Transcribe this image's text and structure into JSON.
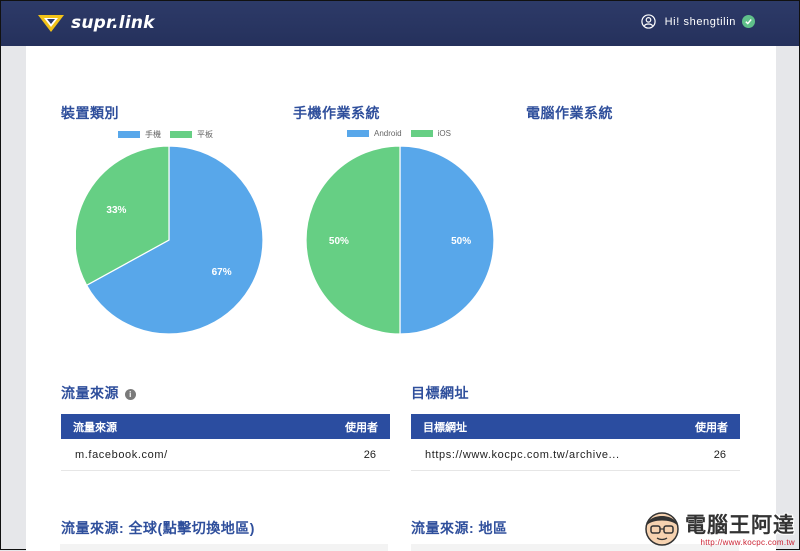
{
  "header": {
    "brand": "supr.link",
    "greeting": "Hi! shengtilin"
  },
  "charts": {
    "device": {
      "title": "裝置類別"
    },
    "mobile_os": {
      "title": "手機作業系統"
    },
    "desktop_os": {
      "title": "電腦作業系統"
    }
  },
  "chart_data": [
    {
      "type": "pie",
      "title": "裝置類別",
      "labels": [
        "手機",
        "平板"
      ],
      "values": [
        67,
        33
      ],
      "value_labels": [
        "67%",
        "33%"
      ],
      "colors": [
        "#58a7ea",
        "#66cf84"
      ],
      "legend": "top"
    },
    {
      "type": "pie",
      "title": "手機作業系統",
      "labels": [
        "Android",
        "iOS"
      ],
      "values": [
        50,
        50
      ],
      "value_labels": [
        "50%",
        "50%"
      ],
      "colors": [
        "#58a7ea",
        "#66cf84"
      ],
      "legend": "top"
    }
  ],
  "traffic": {
    "title": "流量來源",
    "col1": "流量來源",
    "col2": "使用者",
    "rows": [
      {
        "source": "m.facebook.com/",
        "users": "26"
      }
    ]
  },
  "target": {
    "title": "目標網址",
    "col1": "目標網址",
    "col2": "使用者",
    "rows": [
      {
        "url": "https://www.kocpc.com.tw/archive...",
        "users": "26"
      }
    ]
  },
  "sections": {
    "global_map": "流量來源: 全球(點擊切換地區)",
    "region_map": "流量來源: 地區"
  },
  "watermark": {
    "text": "電腦王阿達",
    "url": "http://www.kocpc.com.tw"
  },
  "colors": {
    "header": "#2d3a68",
    "accent": "#2b4da0",
    "blue": "#58a7ea",
    "green": "#66cf84"
  }
}
